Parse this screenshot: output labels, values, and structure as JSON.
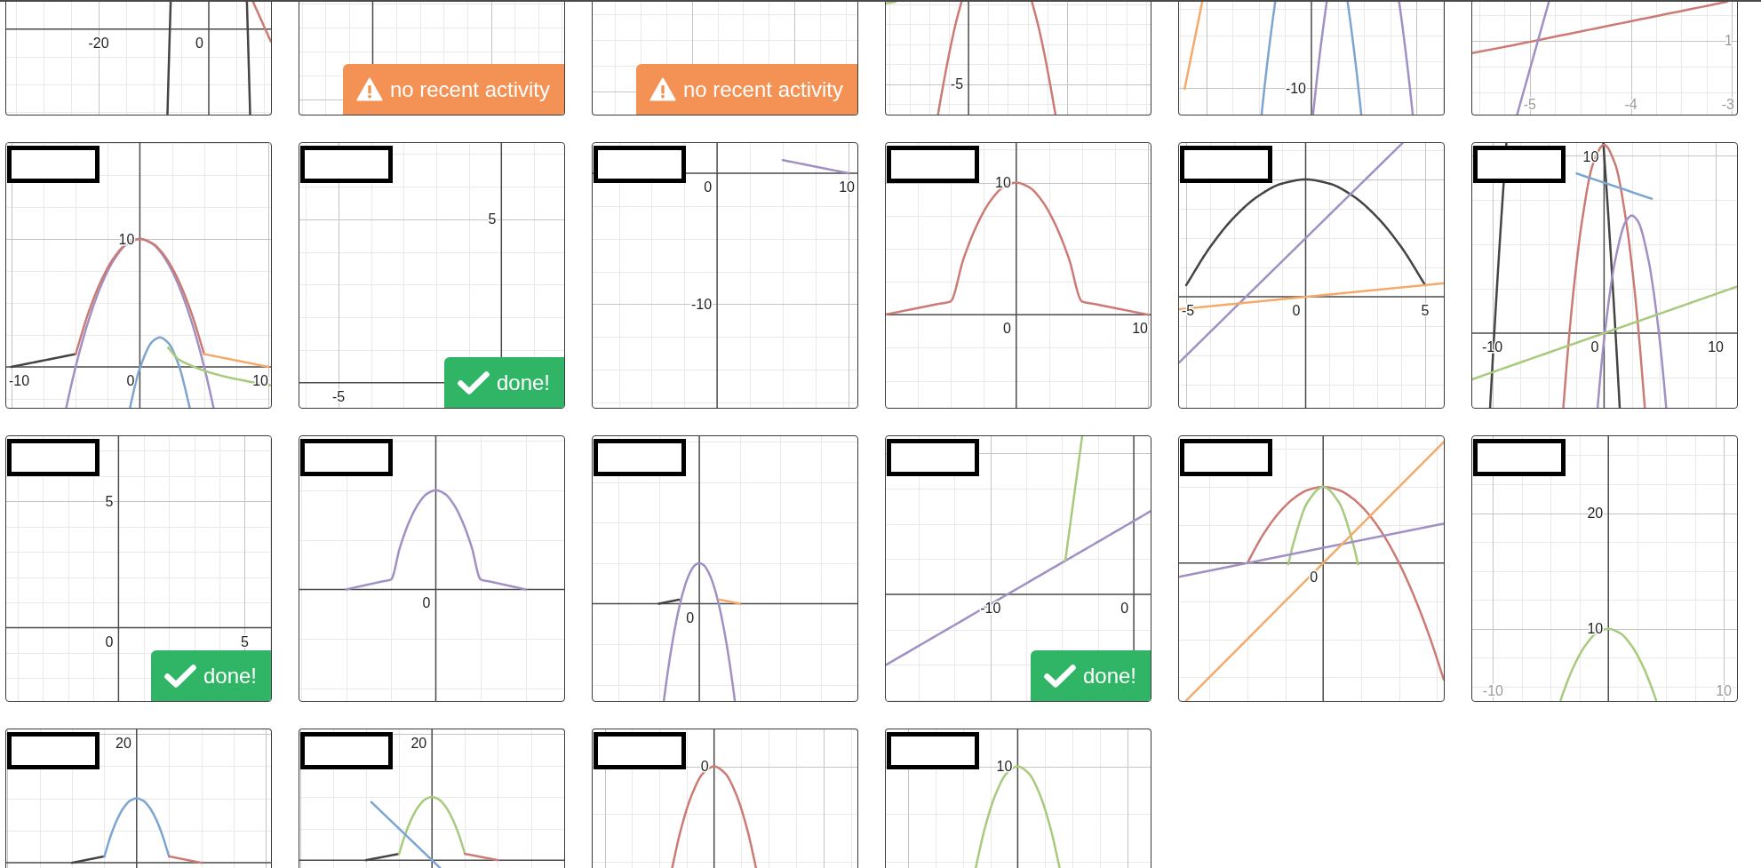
{
  "rows": [
    {
      "cut_off_top": true,
      "cards": [
        {
          "graph": {
            "kind": "steep-curves",
            "axis_labels": [
              "-20",
              "0"
            ]
          }
        },
        {
          "graph": {
            "kind": "blank-grid-fine"
          },
          "status": {
            "kind": "warning",
            "text": "no recent activity"
          }
        },
        {
          "graph": {
            "kind": "blank-grid-coarse"
          },
          "status": {
            "kind": "warning",
            "text": "no recent activity"
          }
        },
        {
          "graph": {
            "kind": "shifted-parabola",
            "axis_labels": [
              "-5"
            ]
          }
        },
        {
          "graph": {
            "kind": "line-and-two-parabolas",
            "axis_labels": [
              "-10"
            ]
          }
        },
        {
          "graph": {
            "kind": "two-crossing-lines",
            "axis_labels": [
              "1",
              "-5",
              "-4",
              "-3"
            ]
          }
        }
      ]
    },
    {
      "cards": [
        {
          "name_redacted": true,
          "graph": {
            "kind": "six-pieces",
            "axis_labels": [
              "10",
              "-10",
              "0",
              "10"
            ]
          }
        },
        {
          "name_redacted": true,
          "graph": {
            "kind": "blank-grid-quadrant",
            "axis_labels": [
              "5",
              "-5"
            ]
          },
          "status": {
            "kind": "done",
            "text": "done!"
          }
        },
        {
          "name_redacted": true,
          "graph": {
            "kind": "short-segment",
            "axis_labels": [
              "0",
              "10",
              "-10"
            ]
          }
        },
        {
          "name_redacted": true,
          "graph": {
            "kind": "red-piecewise",
            "axis_labels": [
              "10",
              "0",
              "10"
            ]
          }
        },
        {
          "name_redacted": true,
          "graph": {
            "kind": "parabola-and-lines",
            "axis_labels": [
              "-5",
              "0",
              "5"
            ]
          }
        },
        {
          "name_redacted": true,
          "graph": {
            "kind": "five-curves",
            "axis_labels": [
              "10",
              "-10",
              "0",
              "10"
            ]
          }
        }
      ]
    },
    {
      "cards": [
        {
          "name_redacted": true,
          "graph": {
            "kind": "blank-grid-origin",
            "axis_labels": [
              "5",
              "0",
              "5"
            ]
          },
          "status": {
            "kind": "done",
            "text": "done!"
          }
        },
        {
          "name_redacted": true,
          "graph": {
            "kind": "purple-piecewise",
            "axis_labels": [
              "0"
            ]
          }
        },
        {
          "name_redacted": true,
          "graph": {
            "kind": "narrow-piecewise",
            "axis_labels": [
              "0"
            ]
          }
        },
        {
          "name_redacted": true,
          "graph": {
            "kind": "bent-line",
            "axis_labels": [
              "-10",
              "0"
            ]
          },
          "status": {
            "kind": "done",
            "text": "done!"
          }
        },
        {
          "name_redacted": true,
          "graph": {
            "kind": "parabolas-and-lines",
            "axis_labels": [
              "0"
            ]
          }
        },
        {
          "name_redacted": true,
          "chart_data": {
            "type": "line",
            "grid": true,
            "xlim": [
              -11.8,
              11.15
            ],
            "ylim": [
              3.77,
              26.65
            ],
            "xticks": [
              -10,
              10
            ],
            "yticks": [
              20,
              10
            ],
            "x": [
              -4.15,
              -4,
              -3,
              -2,
              -1,
              0,
              1,
              2,
              3,
              4,
              4.15
            ],
            "series": [
              {
                "color": "#a8ca7d",
                "values": [
                  3.8,
                  4.24,
                  6.76,
                  8.56,
                  9.64,
                  10,
                  9.64,
                  8.56,
                  6.76,
                  4.24,
                  3.8
                ]
              }
            ]
          }
        }
      ]
    },
    {
      "cut_off_bottom": true,
      "cards": [
        {
          "name_redacted": true,
          "graph": {
            "kind": "blue-piecewise",
            "axis_labels": [
              "20"
            ]
          }
        },
        {
          "name_redacted": true,
          "graph": {
            "kind": "green-piecewise-diagonal",
            "axis_labels": [
              "20"
            ]
          }
        },
        {
          "name_redacted": true,
          "graph": {
            "kind": "red-parabola-top",
            "axis_labels": [
              "0"
            ]
          }
        },
        {
          "name_redacted": true,
          "graph": {
            "kind": "green-parabola-top",
            "axis_labels": [
              "10"
            ]
          }
        }
      ]
    }
  ]
}
